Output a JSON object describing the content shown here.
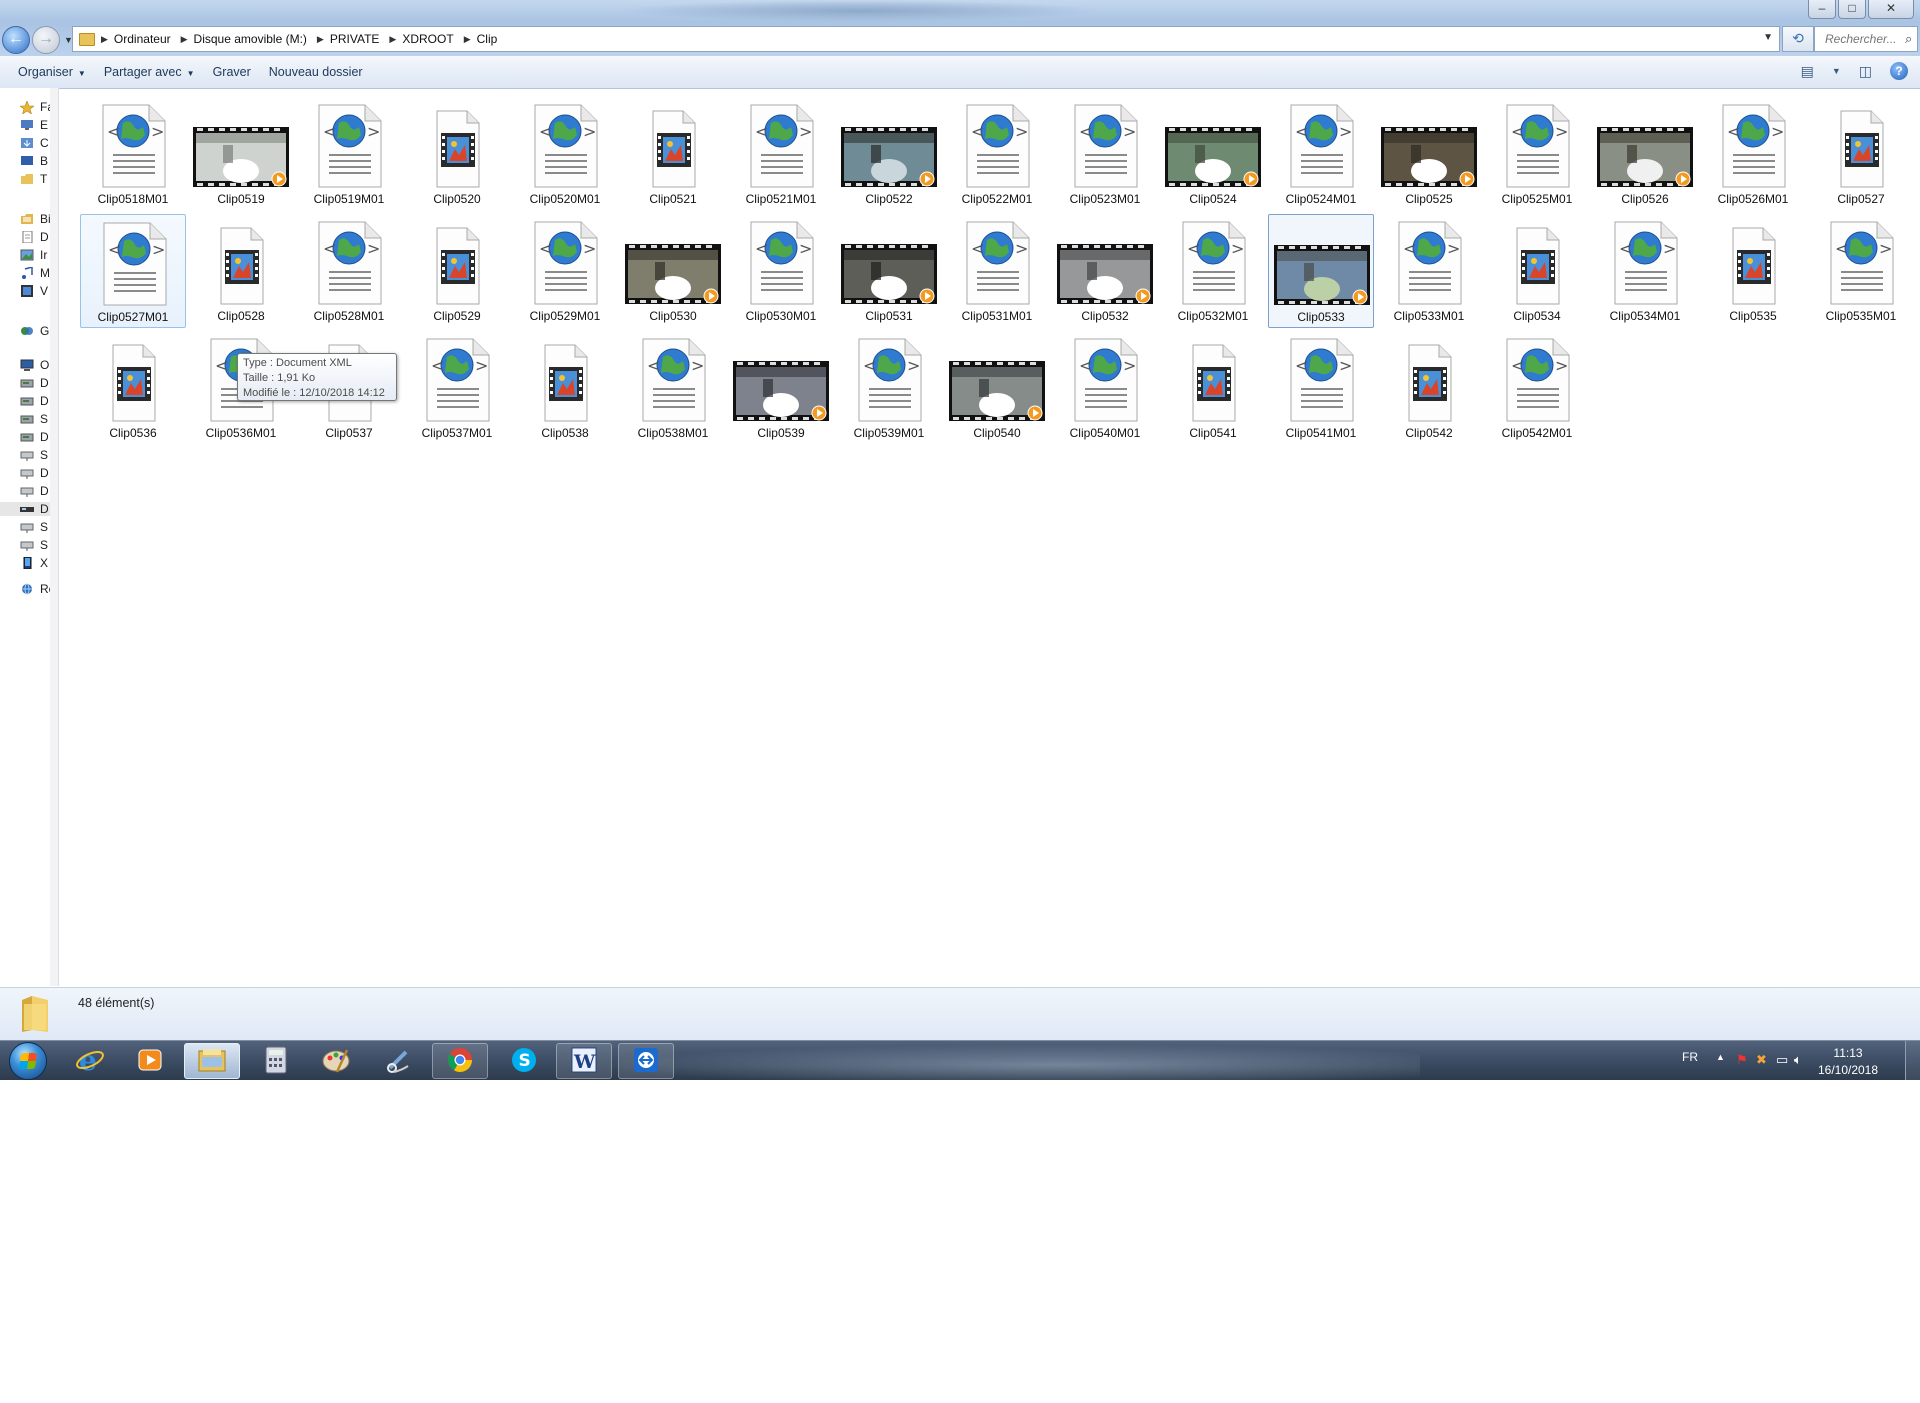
{
  "window": {
    "controls": {
      "minimize": "‒",
      "maximize": "□",
      "close": "✕"
    }
  },
  "address_bar": {
    "breadcrumbs": [
      "Ordinateur",
      "Disque amovible (M:)",
      "PRIVATE",
      "XDROOT",
      "Clip"
    ],
    "search_placeholder": "Rechercher..."
  },
  "toolbar": {
    "organize": "Organiser",
    "share": "Partager avec",
    "burn": "Graver",
    "new_folder": "Nouveau dossier"
  },
  "nav_pane": {
    "items": [
      {
        "label": "Fav",
        "icon": "star-icon"
      },
      {
        "label": "E",
        "icon": "desktop-icon"
      },
      {
        "label": "C",
        "icon": "download-icon"
      },
      {
        "label": "B",
        "icon": "monitor-icon"
      },
      {
        "label": "T",
        "icon": "folder-icon"
      },
      {
        "label": "Bib",
        "icon": "library-icon"
      },
      {
        "label": "D",
        "icon": "document-icon"
      },
      {
        "label": "Ir",
        "icon": "image-icon"
      },
      {
        "label": "M",
        "icon": "music-icon"
      },
      {
        "label": "V",
        "icon": "video-icon"
      },
      {
        "label": "Grc",
        "icon": "homegroup-icon"
      },
      {
        "label": "Orc",
        "icon": "computer-icon"
      },
      {
        "label": "D",
        "icon": "drive-icon"
      },
      {
        "label": "D",
        "icon": "drive-icon"
      },
      {
        "label": "S",
        "icon": "drive-icon"
      },
      {
        "label": "D",
        "icon": "drive-icon"
      },
      {
        "label": "S",
        "icon": "network-drive-icon"
      },
      {
        "label": "D",
        "icon": "network-drive-icon"
      },
      {
        "label": "D",
        "icon": "network-drive-icon"
      },
      {
        "label": "D",
        "icon": "removable-drive-icon"
      },
      {
        "label": "S",
        "icon": "network-drive-icon"
      },
      {
        "label": "S",
        "icon": "network-drive-icon"
      },
      {
        "label": "X",
        "icon": "phone-icon"
      },
      {
        "label": "Rés",
        "icon": "network-icon"
      }
    ]
  },
  "files": [
    {
      "name": "Clip0518M01",
      "type": "xml"
    },
    {
      "name": "Clip0519",
      "type": "video",
      "thumb": "t1"
    },
    {
      "name": "Clip0519M01",
      "type": "xml"
    },
    {
      "name": "Clip0520",
      "type": "film"
    },
    {
      "name": "Clip0520M01",
      "type": "xml"
    },
    {
      "name": "Clip0521",
      "type": "film"
    },
    {
      "name": "Clip0521M01",
      "type": "xml"
    },
    {
      "name": "Clip0522",
      "type": "video",
      "thumb": "t2"
    },
    {
      "name": "Clip0522M01",
      "type": "xml"
    },
    {
      "name": "Clip0523M01",
      "type": "xml"
    },
    {
      "name": "Clip0524",
      "type": "video",
      "thumb": "t3"
    },
    {
      "name": "Clip0524M01",
      "type": "xml"
    },
    {
      "name": "Clip0525",
      "type": "video",
      "thumb": "t4"
    },
    {
      "name": "Clip0525M01",
      "type": "xml"
    },
    {
      "name": "Clip0526",
      "type": "video",
      "thumb": "t5"
    },
    {
      "name": "Clip0526M01",
      "type": "xml"
    },
    {
      "name": "Clip0527",
      "type": "film"
    },
    {
      "name": "Clip0527M01",
      "type": "xml",
      "state": "hover"
    },
    {
      "name": "Clip0528",
      "type": "film"
    },
    {
      "name": "Clip0528M01",
      "type": "xml"
    },
    {
      "name": "Clip0529",
      "type": "film"
    },
    {
      "name": "Clip0529M01",
      "type": "xml"
    },
    {
      "name": "Clip0530",
      "type": "video",
      "thumb": "t6"
    },
    {
      "name": "Clip0530M01",
      "type": "xml"
    },
    {
      "name": "Clip0531",
      "type": "video",
      "thumb": "t7"
    },
    {
      "name": "Clip0531M01",
      "type": "xml"
    },
    {
      "name": "Clip0532",
      "type": "video",
      "thumb": "t8"
    },
    {
      "name": "Clip0532M01",
      "type": "xml"
    },
    {
      "name": "Clip0533",
      "type": "video",
      "thumb": "t9",
      "state": "selected"
    },
    {
      "name": "Clip0533M01",
      "type": "xml"
    },
    {
      "name": "Clip0534",
      "type": "film"
    },
    {
      "name": "Clip0534M01",
      "type": "xml"
    },
    {
      "name": "Clip0535",
      "type": "film"
    },
    {
      "name": "Clip0535M01",
      "type": "xml"
    },
    {
      "name": "Clip0536",
      "type": "film"
    },
    {
      "name": "Clip0536M01",
      "type": "xml"
    },
    {
      "name": "Clip0537",
      "type": "film"
    },
    {
      "name": "Clip0537M01",
      "type": "xml"
    },
    {
      "name": "Clip0538",
      "type": "film"
    },
    {
      "name": "Clip0538M01",
      "type": "xml"
    },
    {
      "name": "Clip0539",
      "type": "video",
      "thumb": "t10"
    },
    {
      "name": "Clip0539M01",
      "type": "xml"
    },
    {
      "name": "Clip0540",
      "type": "video",
      "thumb": "t11"
    },
    {
      "name": "Clip0540M01",
      "type": "xml"
    },
    {
      "name": "Clip0541",
      "type": "film"
    },
    {
      "name": "Clip0541M01",
      "type": "xml"
    },
    {
      "name": "Clip0542",
      "type": "film"
    },
    {
      "name": "Clip0542M01",
      "type": "xml"
    }
  ],
  "tooltip": {
    "type": "Type : Document XML",
    "size": "Taille : 1,91 Ko",
    "modified": "Modifié le : 12/10/2018 14:12"
  },
  "details": {
    "item_count": "48 élément(s)"
  },
  "taskbar": {
    "apps": [
      {
        "icon": "internet-explorer-icon",
        "state": "pinned"
      },
      {
        "icon": "media-player-icon",
        "state": "pinned"
      },
      {
        "icon": "file-explorer-icon",
        "state": "active"
      },
      {
        "icon": "calculator-icon",
        "state": "pinned"
      },
      {
        "icon": "paint-icon",
        "state": "pinned"
      },
      {
        "icon": "snipping-tool-icon",
        "state": "pinned"
      },
      {
        "icon": "chrome-icon",
        "state": "open"
      },
      {
        "icon": "skype-icon",
        "state": "pinned"
      },
      {
        "icon": "word-icon",
        "state": "open"
      },
      {
        "icon": "teamviewer-icon",
        "state": "open"
      }
    ],
    "tray": {
      "language": "FR",
      "time": "11:13",
      "date": "16/10/2018"
    }
  },
  "colors": {
    "accent": "#3c6aa8",
    "selection_border": "#99c2ea",
    "taskbar": "#3f5068"
  }
}
